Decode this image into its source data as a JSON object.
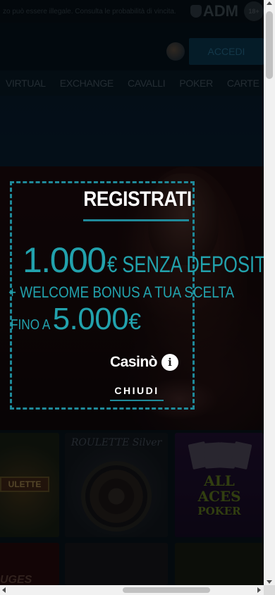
{
  "topbar": {
    "warning": "zo può essere illegale. Consulta le probabilità di vincita.",
    "adm_label": "ADM",
    "age_label": "18+"
  },
  "header": {
    "login_label": "ACCEDI",
    "language_icon": "globe-flag-icon"
  },
  "nav": {
    "items": [
      "VIRTUAL",
      "EXCHANGE",
      "CAVALLI",
      "POKER",
      "CARTE"
    ]
  },
  "promo": {
    "title": "REGISTRATI",
    "amount": "1.000",
    "amount_suffix": "€ SENZA DEPOSITO",
    "welcome": "+ WELCOME BONUS A TUA SCELTA",
    "upto_prefix": "FINO A ",
    "upto_amount": "5.000",
    "upto_currency": "€",
    "category": "Casinò",
    "info_symbol": "i",
    "close_label": "CHIUDI"
  },
  "games": {
    "tile1_label": "ULETTE",
    "tile2_label": "ROULETTE Silver",
    "tile3_line1": "ALL",
    "tile3_line2": "ACES",
    "tile3_line3": "POKER",
    "tile4_label": "UGES"
  },
  "colors": {
    "accent": "#1f8a9a",
    "promo_text": "#22a2ad",
    "login_bg": "#0c3e5a"
  }
}
